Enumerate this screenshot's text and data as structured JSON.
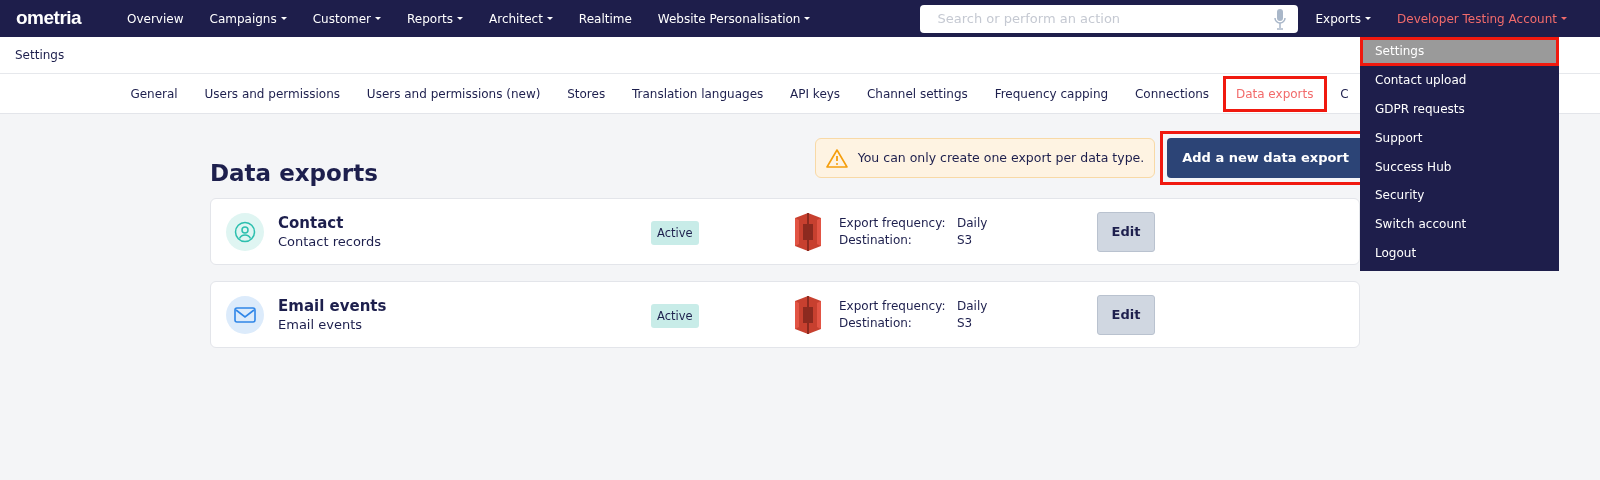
{
  "logo": "ometria",
  "nav": [
    {
      "label": "Overview",
      "dropdown": false
    },
    {
      "label": "Campaigns",
      "dropdown": true
    },
    {
      "label": "Customer",
      "dropdown": true
    },
    {
      "label": "Reports",
      "dropdown": true
    },
    {
      "label": "Architect",
      "dropdown": true
    },
    {
      "label": "Realtime",
      "dropdown": false
    },
    {
      "label": "Website Personalisation",
      "dropdown": true
    }
  ],
  "search": {
    "placeholder": "Search or perform an action"
  },
  "exports_menu": {
    "label": "Exports"
  },
  "account_menu": {
    "label": "Developer Testing Account",
    "expanded": true,
    "items": [
      {
        "label": "Settings",
        "selected": true,
        "highlighted": true
      },
      {
        "label": "Contact upload",
        "selected": false,
        "highlighted": false
      },
      {
        "label": "GDPR requests",
        "selected": false,
        "highlighted": false
      },
      {
        "label": "Support",
        "selected": false,
        "highlighted": false
      },
      {
        "label": "Success Hub",
        "selected": false,
        "highlighted": false
      },
      {
        "label": "Security",
        "selected": false,
        "highlighted": false
      },
      {
        "label": "Switch account",
        "selected": false,
        "highlighted": false
      },
      {
        "label": "Logout",
        "selected": false,
        "highlighted": false
      }
    ]
  },
  "breadcrumb": "Settings",
  "tabs": [
    {
      "label": "General",
      "selected": false,
      "highlighted": false
    },
    {
      "label": "Users and permissions",
      "selected": false,
      "highlighted": false
    },
    {
      "label": "Users and permissions (new)",
      "selected": false,
      "highlighted": false
    },
    {
      "label": "Stores",
      "selected": false,
      "highlighted": false
    },
    {
      "label": "Translation languages",
      "selected": false,
      "highlighted": false
    },
    {
      "label": "API keys",
      "selected": false,
      "highlighted": false
    },
    {
      "label": "Channel settings",
      "selected": false,
      "highlighted": false
    },
    {
      "label": "Frequency capping",
      "selected": false,
      "highlighted": false
    },
    {
      "label": "Connections",
      "selected": false,
      "highlighted": false
    },
    {
      "label": "Data exports",
      "selected": true,
      "highlighted": true
    },
    {
      "label": "C",
      "selected": false,
      "highlighted": false
    }
  ],
  "page_title": "Data exports",
  "notice": "You can only create one export per data type.",
  "add_button": {
    "label": "Add a new data export",
    "highlighted": true
  },
  "exports": [
    {
      "kind": "contact",
      "name": "Contact",
      "description": "Contact records",
      "status": "Active",
      "frequency_label": "Export frequency:",
      "frequency": "Daily",
      "destination_label": "Destination:",
      "destination": "S3",
      "action": "Edit"
    },
    {
      "kind": "email",
      "name": "Email events",
      "description": "Email events",
      "status": "Active",
      "frequency_label": "Export frequency:",
      "frequency": "Daily",
      "destination_label": "Destination:",
      "destination": "S3",
      "action": "Edit"
    }
  ]
}
